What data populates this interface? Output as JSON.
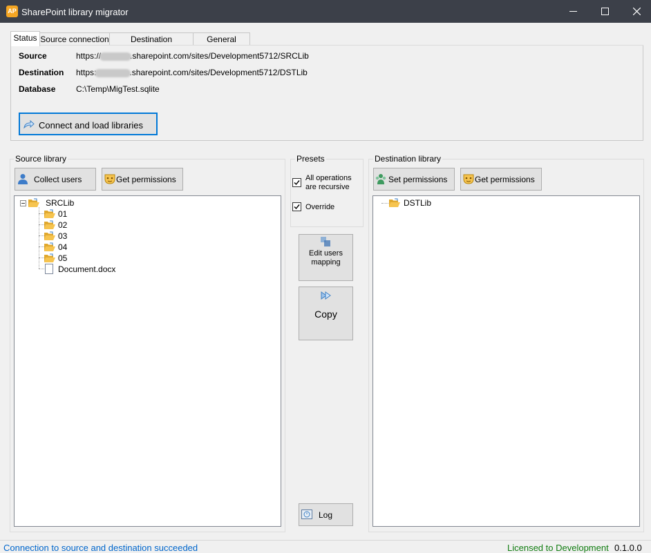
{
  "window": {
    "title": "SharePoint library migrator",
    "app_icon_text": "AP"
  },
  "tabs": [
    {
      "label": "Status",
      "active": true
    },
    {
      "label": "Source connection",
      "active": false
    },
    {
      "label": "Destination connection",
      "active": false
    },
    {
      "label": "General setting",
      "active": false
    }
  ],
  "status": {
    "source_label": "Source",
    "source_prefix": "https://",
    "source_suffix": ".sharepoint.com/sites/Development5712/SRCLib",
    "destination_label": "Destination",
    "destination_prefix": "https:",
    "destination_suffix": ".sharepoint.com/sites/Development5712/DSTLib",
    "database_label": "Database",
    "database_value": "C:\\Temp\\MigTest.sqlite",
    "connect_button": "Connect and load libraries"
  },
  "source_library": {
    "title": "Source library",
    "collect_users_button": "Collect users",
    "get_permissions_button": "Get permissions",
    "tree": {
      "root": "SRCLib",
      "children": [
        "01",
        "02",
        "03",
        "04",
        "05",
        "Document.docx"
      ]
    }
  },
  "presets": {
    "title": "Presets",
    "recursive_label": "All operations are recursive",
    "recursive_checked": true,
    "override_label": "Override",
    "override_checked": true
  },
  "actions": {
    "edit_users_mapping": "Edit users mapping",
    "copy": "Copy",
    "log": "Log"
  },
  "destination_library": {
    "title": "Destination library",
    "set_permissions_button": "Set permissions",
    "get_permissions_button": "Get permissions",
    "tree": {
      "root": "DSTLib"
    }
  },
  "statusbar": {
    "message": "Connection to source and destination succeeded",
    "license": "Licensed to Development",
    "version": "0.1.0.0"
  },
  "colors": {
    "titlebar": "#3c4049",
    "accent": "#0078d7",
    "status_message": "#0066cc",
    "license_text": "#107c10",
    "folder": "#f6c44f"
  }
}
